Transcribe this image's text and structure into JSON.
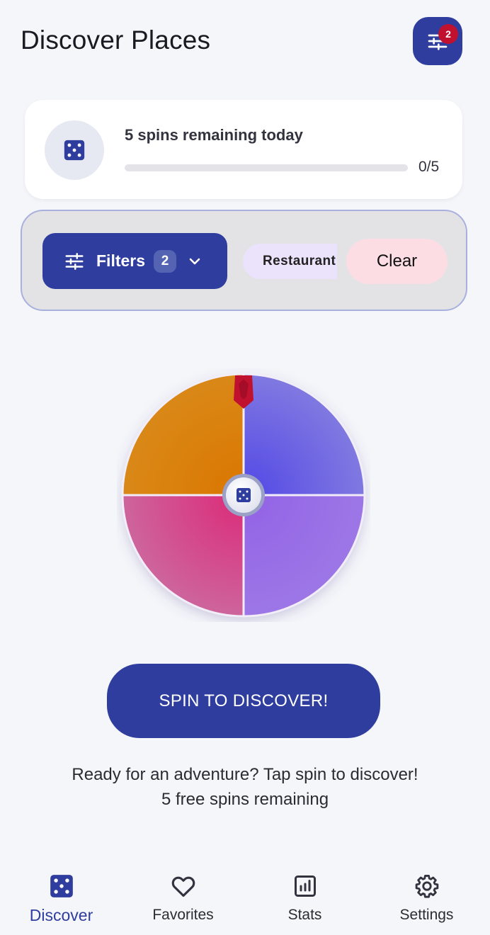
{
  "header": {
    "title": "Discover Places",
    "filter_badge": "2"
  },
  "spins_card": {
    "label": "5 spins remaining today",
    "progress_text": "0/5",
    "progress_fraction": 0
  },
  "filters": {
    "button_label": "Filters",
    "active_count": "2",
    "chips": [
      "Restaurant"
    ],
    "clear_label": "Clear"
  },
  "wheel": {
    "segment_colors": [
      "#6457e6",
      "#9a72e6",
      "#d4508d",
      "#dc7a05"
    ],
    "pointer_color": "#c0112f"
  },
  "spin_button": {
    "label": "SPIN TO DISCOVER!"
  },
  "messages": {
    "line1": "Ready for an adventure? Tap spin to discover!",
    "line2": "5 free spins remaining"
  },
  "nav": {
    "items": [
      {
        "label": "Discover",
        "icon": "dice-icon",
        "active": true
      },
      {
        "label": "Favorites",
        "icon": "heart-icon",
        "active": false
      },
      {
        "label": "Stats",
        "icon": "stats-icon",
        "active": false
      },
      {
        "label": "Settings",
        "icon": "gear-icon",
        "active": false
      }
    ]
  },
  "colors": {
    "primary": "#2f3e9e",
    "background": "#f5f6fa",
    "badge": "#c0112f",
    "chip": "#ebe2fb",
    "clear": "#fcdde4"
  }
}
